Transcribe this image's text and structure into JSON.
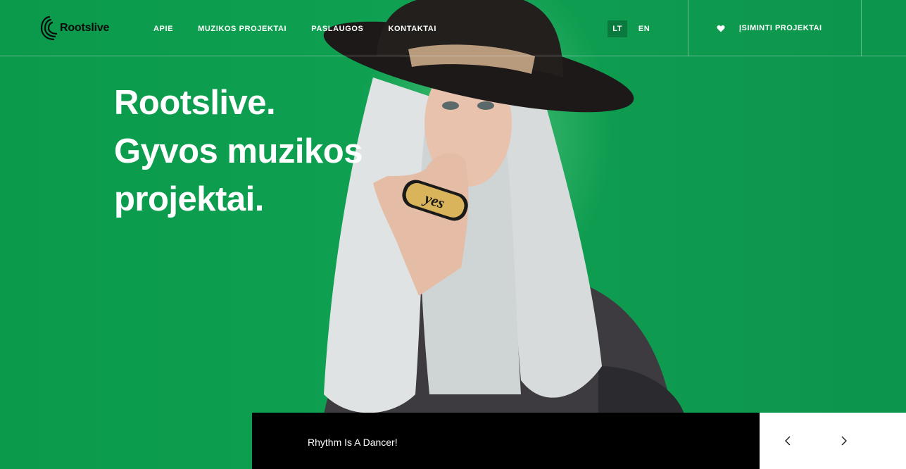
{
  "brand": {
    "name": "Rootslive"
  },
  "nav": {
    "items": [
      {
        "label": "APIE"
      },
      {
        "label": "MUZIKOS PROJEKTAI"
      },
      {
        "label": "PASLAUGOS"
      },
      {
        "label": "KONTAKTAI"
      }
    ]
  },
  "languages": [
    {
      "label": "LT",
      "active": true
    },
    {
      "label": "EN",
      "active": false
    }
  ],
  "saved": {
    "label": "ĮSIMINTI PROJEKTAI",
    "icon": "heart-icon"
  },
  "hero": {
    "lines": [
      "Rootslive.",
      "Gyvos muzikos",
      "projektai."
    ],
    "ring_text": "yes"
  },
  "slider": {
    "caption": "Rhythm Is A Dancer!",
    "prev_icon": "chevron-left-icon",
    "next_icon": "chevron-right-icon"
  },
  "colors": {
    "accent_green": "#0f9d4f",
    "caption_bg": "#000000",
    "text": "#ffffff"
  }
}
